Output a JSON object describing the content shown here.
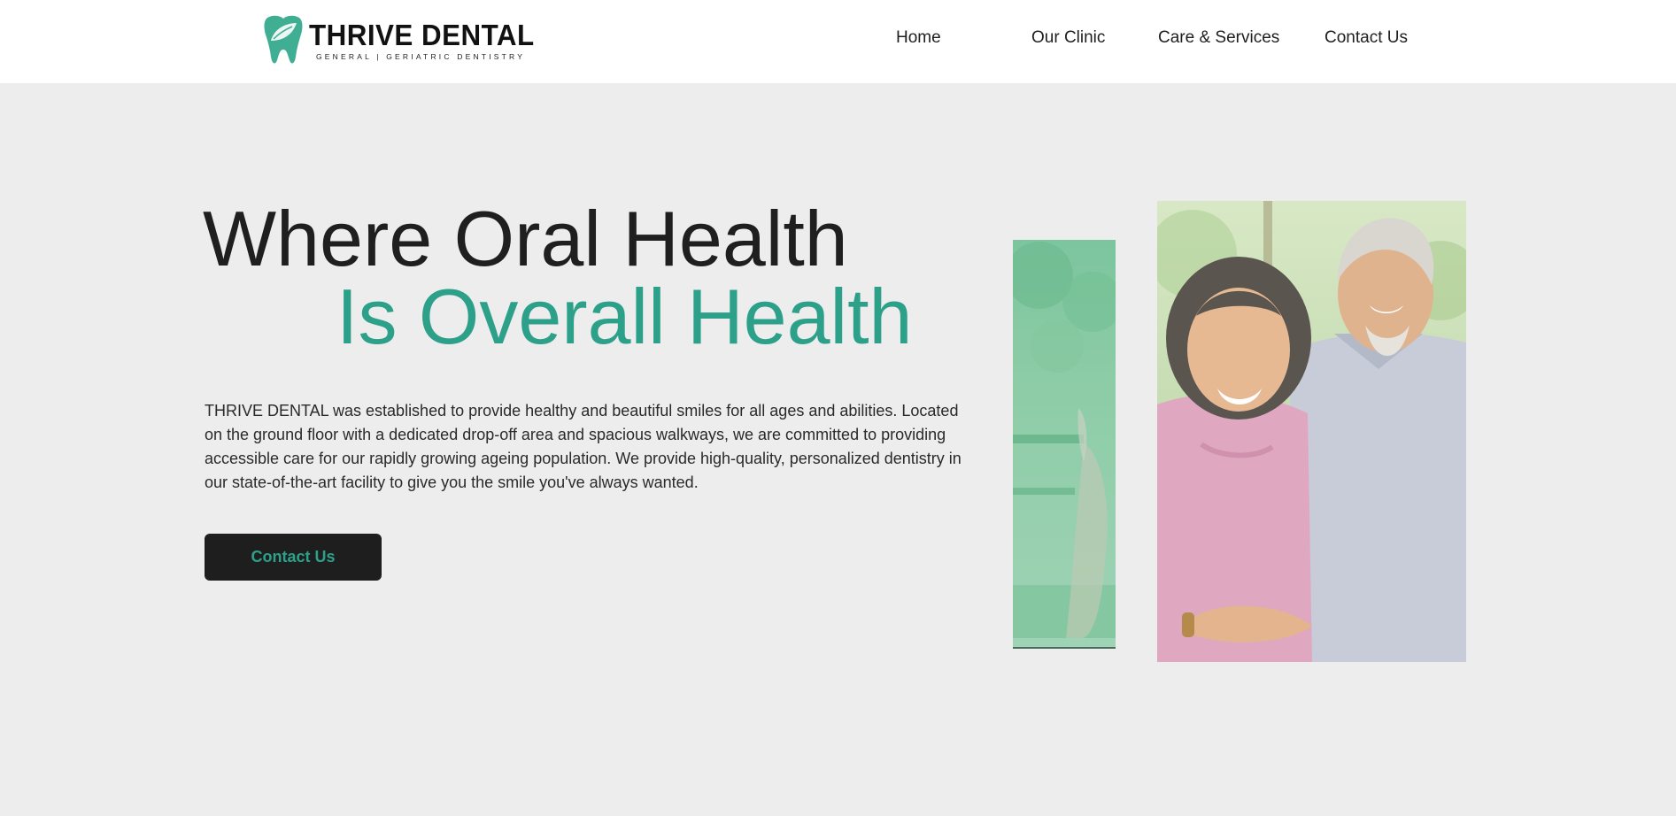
{
  "brand": {
    "name": "THRIVE DENTAL",
    "tagline": "GENERAL   |   GERIATRIC DENTISTRY",
    "accent_color": "#2da08a",
    "icon": "tooth-leaf-icon"
  },
  "nav": {
    "items": [
      {
        "label": "Home"
      },
      {
        "label": "Our Clinic"
      },
      {
        "label": "Care & Services"
      },
      {
        "label": "Contact Us"
      }
    ]
  },
  "hero": {
    "headline_line1": "Where Oral Health",
    "headline_line2": "Is Overall Health",
    "intro": "THRIVE DENTAL was established to provide healthy and beautiful smiles for all ages and abilities. Located on the ground floor with a dedicated drop-off area and spacious walkways, we are committed to providing accessible care for our rapidly growing ageing population. We provide high-quality, personalized dentistry in our state-of-the-art facility to give you the smile you've always wanted.",
    "cta_label": "Contact Us"
  },
  "colors": {
    "page_bg": "#ededed",
    "header_bg": "#ffffff",
    "text_dark": "#1f1f1f",
    "button_bg": "#1e1e1e"
  }
}
